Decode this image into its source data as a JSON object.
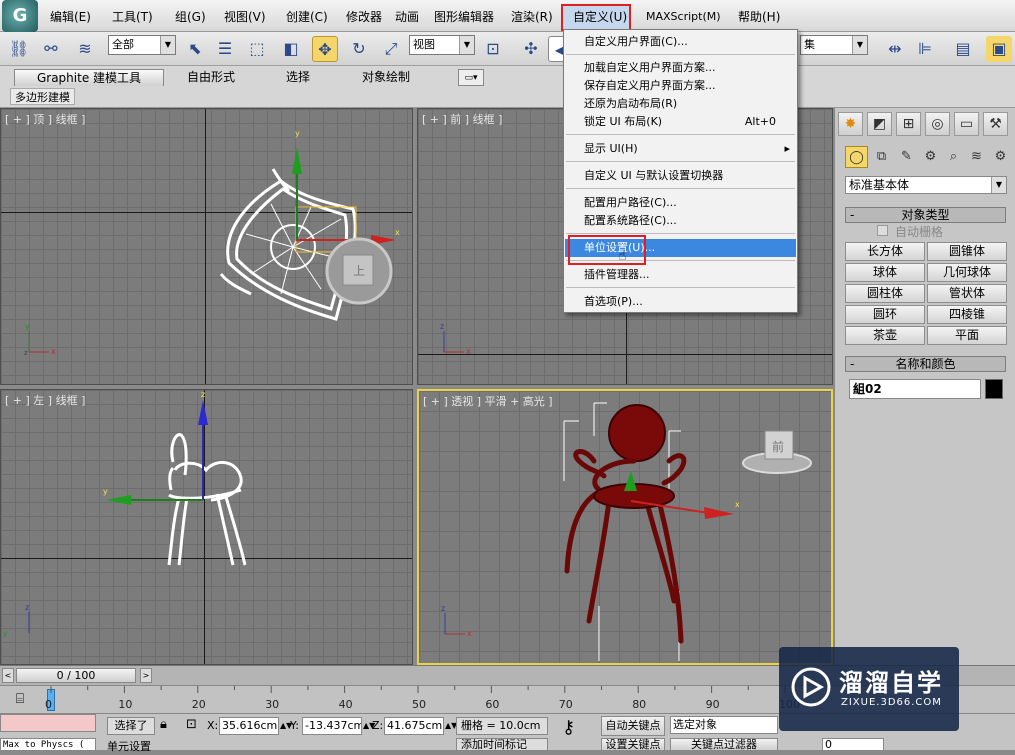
{
  "menubar": {
    "items": [
      "编辑(E)",
      "工具(T)",
      "组(G)",
      "视图(V)",
      "创建(C)",
      "修改器",
      "动画",
      "图形编辑器",
      "渲染(R)",
      "自定义(U)",
      "MAXScript(M)",
      "帮助(H)"
    ]
  },
  "toolbar": {
    "selection_filter": "全部",
    "ref_coord": "视图",
    "named_selection": "集"
  },
  "ribbon": {
    "tabs": [
      "Graphite 建模工具",
      "自由形式",
      "选择",
      "对象绘制"
    ],
    "panel_label": "多边形建模"
  },
  "viewports": {
    "top": "[ + ] 顶 ] 线框 ]",
    "front": "[ + ] 前 ] 线框 ]",
    "left": "[ + ] 左 ] 线框 ]",
    "perspective": "[ + ] 透视 ] 平滑 + 高光 ]",
    "viewcube_top": "上",
    "viewcube_persp": "前"
  },
  "dropdown": {
    "items": [
      {
        "label": "自定义用户界面(C)...",
        "shortcut": ""
      },
      {
        "label": "加载自定义用户界面方案...",
        "shortcut": ""
      },
      {
        "label": "保存自定义用户界面方案...",
        "shortcut": ""
      },
      {
        "label": "还原为启动布局(R)",
        "shortcut": ""
      },
      {
        "label": "锁定 UI 布局(K)",
        "shortcut": "Alt+0"
      },
      {
        "label": "显示 UI(H)",
        "shortcut": "▸"
      },
      {
        "label": "自定义 UI 与默认设置切换器",
        "shortcut": ""
      },
      {
        "label": "配置用户路径(C)...",
        "shortcut": ""
      },
      {
        "label": "配置系统路径(C)...",
        "shortcut": ""
      },
      {
        "label": "单位设置(U)...",
        "shortcut": ""
      },
      {
        "label": "插件管理器...",
        "shortcut": ""
      },
      {
        "label": "首选项(P)...",
        "shortcut": ""
      }
    ]
  },
  "command_panel": {
    "category": "标准基本体",
    "object_type_title": "对象类型",
    "autogrid": "自动栅格",
    "buttons": [
      "长方体",
      "圆锥体",
      "球体",
      "几何球体",
      "圆柱体",
      "管状体",
      "圆环",
      "四棱锥",
      "茶壶",
      "平面"
    ],
    "name_color_title": "名称和颜色",
    "object_name": "組02",
    "object_color": "#000000"
  },
  "timeline": {
    "frame": "0 / 100",
    "ticks": [
      "0",
      "10",
      "20",
      "30",
      "40",
      "50",
      "60",
      "70",
      "80",
      "90",
      "100"
    ]
  },
  "status": {
    "selected": "选择了",
    "x_label": "X:",
    "x": "35.616cm",
    "y_label": "Y:",
    "y": "-13.437cm",
    "z_label": "Z:",
    "z": "41.675cm",
    "grid": "栅格 = 10.0cm",
    "autokey": "自动关键点",
    "setkey": "设置关键点",
    "selected_object": "选定对象",
    "key_filters": "关键点过滤器",
    "add_time_tag": "添加时间标记",
    "prompt": "单元设置",
    "maxscript": "Max to Physcs (",
    "frame_field": "0"
  },
  "watermark": {
    "title": "溜溜自学",
    "url": "ZIXUE.3D66.COM"
  }
}
